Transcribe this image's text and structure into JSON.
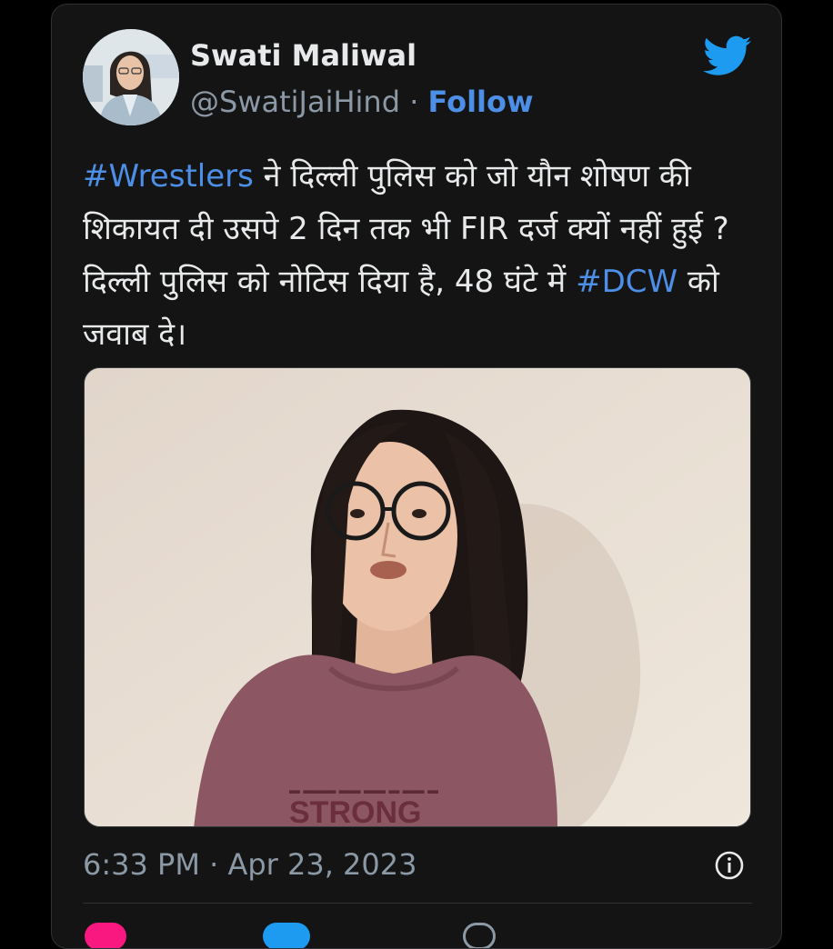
{
  "author": {
    "name": "Swati Maliwal",
    "handle": "@SwatiJaiHind",
    "separator": " · ",
    "follow_label": "Follow"
  },
  "tweet": {
    "parts": [
      {
        "text": "#Wrestlers",
        "hashtag": true
      },
      {
        "text": " ने दिल्ली पुलिस को जो यौन शोषण की शिकायत दी उसपे 2 दिन तक भी FIR दर्ज क्यों नहीं हुई ? दिल्ली पुलिस को नोटिस दिया है, 48 घंटे में ",
        "hashtag": false
      },
      {
        "text": "#DCW",
        "hashtag": true
      },
      {
        "text": " को जवाब दे।",
        "hashtag": false
      }
    ]
  },
  "media": {
    "shirt_text": "STRONG"
  },
  "timestamp": "6:33 PM · Apr 23, 2023",
  "icons": [
    "twitter-bird-icon",
    "info-icon",
    "heart-icon",
    "reply-icon",
    "share-icon"
  ],
  "colors": {
    "background": "#000000",
    "card": "#141414",
    "text": "#e7e9ea",
    "muted": "#8b98a5",
    "accent": "#4d8fe6",
    "twitter_blue": "#1d9bf0",
    "like_pink": "#f91880"
  }
}
